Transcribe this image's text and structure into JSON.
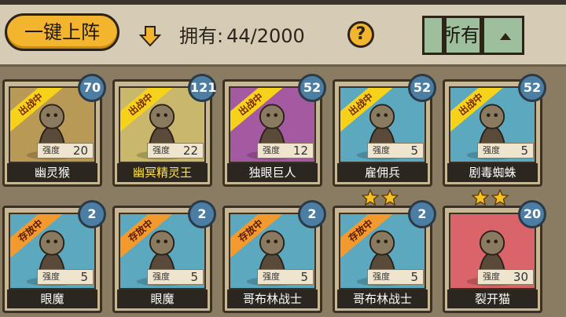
{
  "toolbar": {
    "deploy_label": "一键上阵",
    "own_label": "拥有:",
    "own_count": "44/2000",
    "help_label": "?",
    "filter_label": "所有"
  },
  "cards": [
    {
      "name": "幽灵猴",
      "level": "70",
      "power_label": "强度",
      "power": "20",
      "ribbon": "出战中",
      "ribbon_type": "battle",
      "bg": "#b89a56",
      "stars": 0,
      "name_gold": false
    },
    {
      "name": "幽冥精灵王",
      "level": "121",
      "power_label": "强度",
      "power": "22",
      "ribbon": "出战中",
      "ribbon_type": "battle",
      "bg": "#c9b76b",
      "stars": 0,
      "name_gold": true
    },
    {
      "name": "独眼巨人",
      "level": "52",
      "power_label": "强度",
      "power": "12",
      "ribbon": "出战中",
      "ribbon_type": "battle",
      "bg": "#a45aa0",
      "stars": 0,
      "name_gold": false
    },
    {
      "name": "雇佣兵",
      "level": "52",
      "power_label": "强度",
      "power": "5",
      "ribbon": "出战中",
      "ribbon_type": "battle",
      "bg": "#5ca8bf",
      "stars": 2,
      "name_gold": false
    },
    {
      "name": "剧毒蜘蛛",
      "level": "52",
      "power_label": "强度",
      "power": "5",
      "ribbon": "出战中",
      "ribbon_type": "battle",
      "bg": "#5ca8bf",
      "stars": 2,
      "name_gold": false
    },
    {
      "name": "眼魔",
      "level": "2",
      "power_label": "强度",
      "power": "5",
      "ribbon": "存放中",
      "ribbon_type": "storage",
      "bg": "#5ca8bf",
      "stars": 0,
      "name_gold": false
    },
    {
      "name": "眼魔",
      "level": "2",
      "power_label": "强度",
      "power": "5",
      "ribbon": "存放中",
      "ribbon_type": "storage",
      "bg": "#5ca8bf",
      "stars": 0,
      "name_gold": false
    },
    {
      "name": "哥布林战士",
      "level": "2",
      "power_label": "强度",
      "power": "5",
      "ribbon": "存放中",
      "ribbon_type": "storage",
      "bg": "#5ca8bf",
      "stars": 0,
      "name_gold": false
    },
    {
      "name": "哥布林战士",
      "level": "2",
      "power_label": "强度",
      "power": "5",
      "ribbon": "存放中",
      "ribbon_type": "storage",
      "bg": "#5ca8bf",
      "stars": 0,
      "name_gold": false
    },
    {
      "name": "裂开猫",
      "level": "20",
      "power_label": "强度",
      "power": "30",
      "ribbon": "",
      "ribbon_type": "none",
      "bg": "#d9646a",
      "stars": 0,
      "name_gold": false
    }
  ]
}
